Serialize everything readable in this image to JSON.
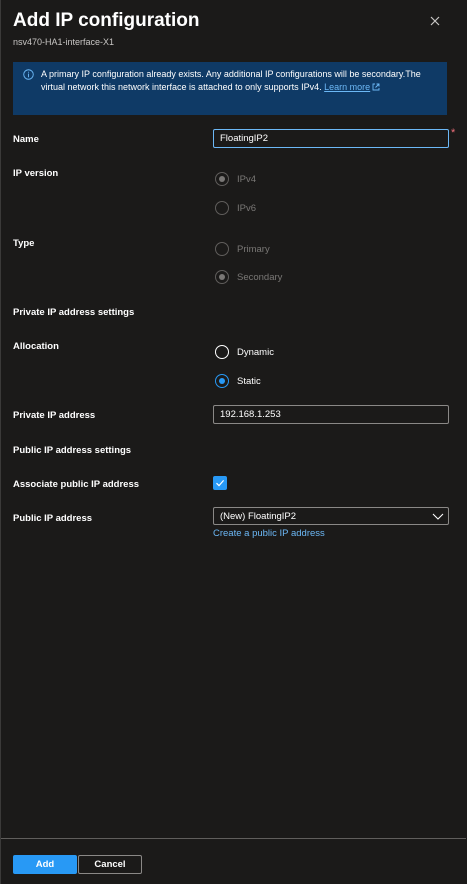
{
  "header": {
    "title": "Add IP configuration",
    "subtitle": "nsv470-HA1-interface-X1",
    "close_icon": "close-icon"
  },
  "info": {
    "icon": "info-icon",
    "text": "A primary IP configuration already exists. Any additional IP configurations will be secondary.The virtual network this network interface is attached to only supports IPv4.",
    "link_text": "Learn more",
    "link_icon": "external-link-icon"
  },
  "form": {
    "name": {
      "label": "Name",
      "value": "FloatingIP2",
      "required_mark": "*"
    },
    "ip_version": {
      "label": "IP version",
      "options": [
        {
          "label": "IPv4",
          "checked": true,
          "disabled": true
        },
        {
          "label": "IPv6",
          "checked": false,
          "disabled": true
        }
      ]
    },
    "type": {
      "label": "Type",
      "options": [
        {
          "label": "Primary",
          "checked": false,
          "disabled": true
        },
        {
          "label": "Secondary",
          "checked": true,
          "disabled": true
        }
      ]
    },
    "private_section_title": "Private IP address settings",
    "allocation": {
      "label": "Allocation",
      "options": [
        {
          "label": "Dynamic",
          "checked": false,
          "disabled": false
        },
        {
          "label": "Static",
          "checked": true,
          "disabled": false
        }
      ]
    },
    "private_ip": {
      "label": "Private IP address",
      "value": "192.168.1.253"
    },
    "public_section_title": "Public IP address settings",
    "associate_public": {
      "label": "Associate public IP address",
      "checked": true
    },
    "public_ip": {
      "label": "Public IP address",
      "selected": "(New) FloatingIP2",
      "create_link": "Create a public IP address"
    }
  },
  "footer": {
    "add_label": "Add",
    "cancel_label": "Cancel"
  },
  "colors": {
    "background": "#1b1a19",
    "accent": "#2899f5",
    "info_bar": "#0f3a66",
    "link": "#6cb8f6",
    "required": "#f1707b"
  }
}
